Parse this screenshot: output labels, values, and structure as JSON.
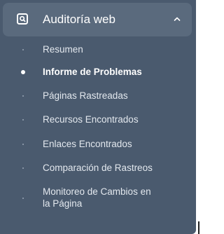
{
  "sidebar": {
    "section_title": "Auditoría web",
    "section_icon": "search-page-icon",
    "expanded_icon": "chevron-up-icon",
    "items": [
      {
        "label": "Resumen",
        "active": false
      },
      {
        "label": "Informe de Problemas",
        "active": true
      },
      {
        "label": "Páginas Rastreadas",
        "active": false
      },
      {
        "label": "Recursos Encontrados",
        "active": false
      },
      {
        "label": "Enlaces Encontrados",
        "active": false
      },
      {
        "label": "Comparación de Rastreos",
        "active": false
      },
      {
        "label_line1": "Monitoreo de Cambios en",
        "label_line2": "la Página",
        "active": false
      }
    ]
  }
}
